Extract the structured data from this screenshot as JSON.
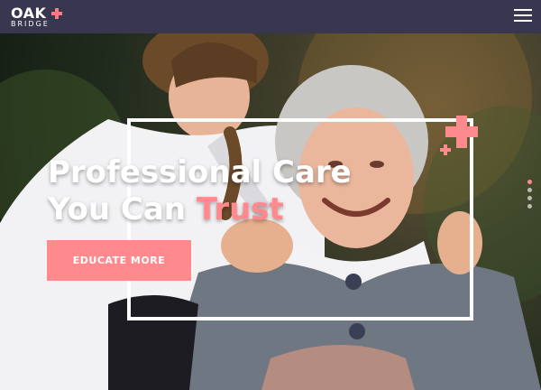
{
  "header": {
    "logo_main": "OAK",
    "logo_sub": "BRIDGE",
    "menu_icon": "hamburger-icon"
  },
  "hero": {
    "headline_line1": "Professional Care",
    "headline_line2_prefix": "You Can ",
    "headline_line2_accent": "Trust",
    "cta_label": "EDUCATE MORE",
    "accent_color": "#ff8a8e",
    "slider": {
      "count": 4,
      "active_index": 1
    }
  }
}
